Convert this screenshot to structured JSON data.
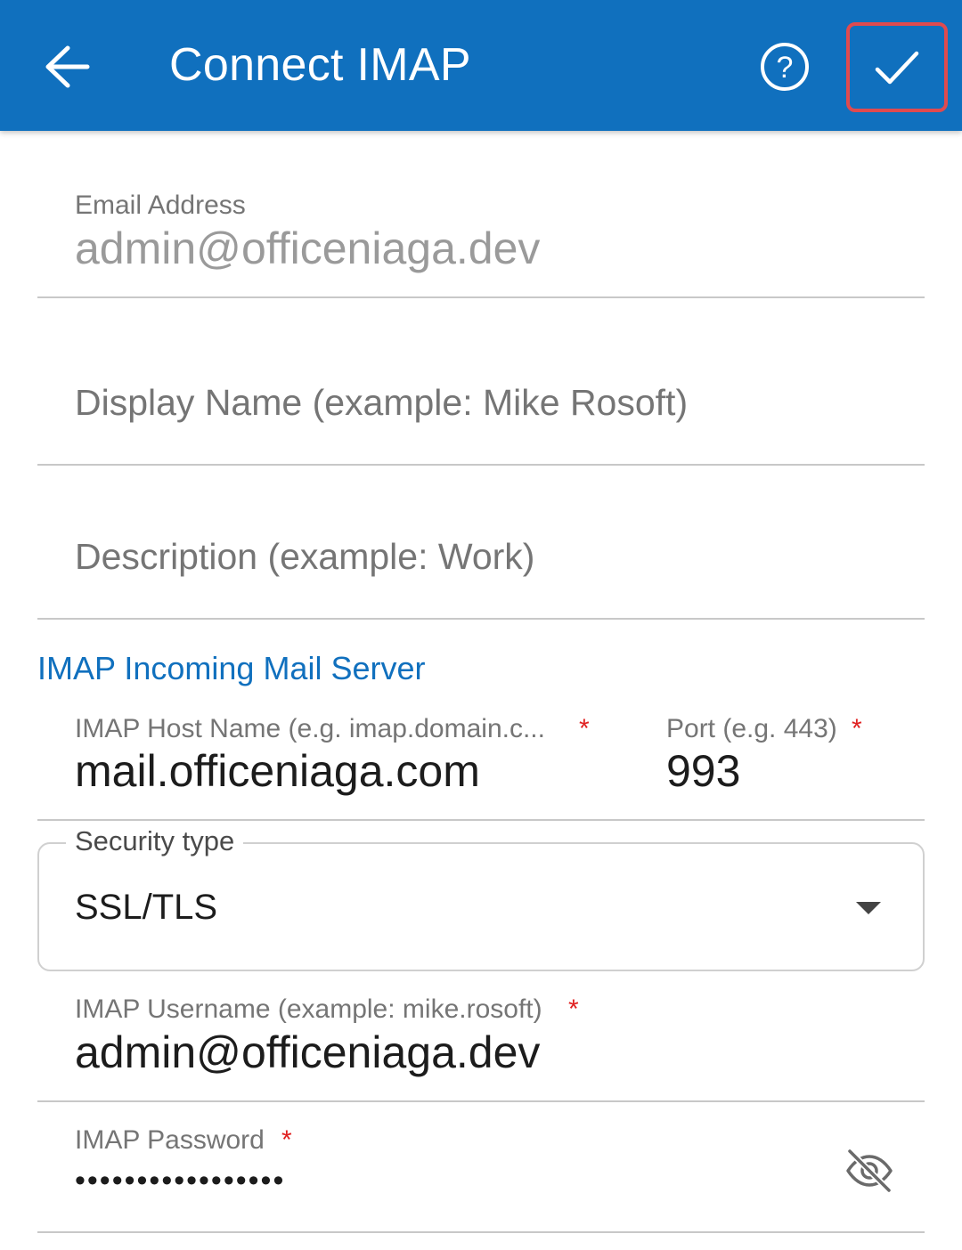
{
  "appbar": {
    "title": "Connect IMAP",
    "back_icon": "arrow-left-icon",
    "help_icon": "help-circle-icon",
    "confirm_icon": "check-icon",
    "background_color": "#1070be"
  },
  "form": {
    "email": {
      "label": "Email Address",
      "value": "admin@officeniaga.dev"
    },
    "display_name": {
      "placeholder": "Display Name (example: Mike Rosoft)",
      "value": ""
    },
    "description": {
      "placeholder": "Description (example: Work)",
      "value": ""
    },
    "incoming_section_title": "IMAP Incoming Mail Server",
    "host": {
      "label": "IMAP Host Name (e.g. imap.domain.c...",
      "required_mark": "*",
      "value": "mail.officeniaga.com"
    },
    "port": {
      "label": "Port (e.g. 443)",
      "required_mark": "*",
      "value": "993"
    },
    "security": {
      "label": "Security type",
      "value": "SSL/TLS"
    },
    "username": {
      "label": "IMAP Username (example: mike.rosoft)",
      "required_mark": "*",
      "value": "admin@officeniaga.dev"
    },
    "password": {
      "label": "IMAP Password",
      "required_mark": "*",
      "masked_value": "•••••••••••••••••",
      "visibility_icon": "eye-off-icon"
    }
  }
}
